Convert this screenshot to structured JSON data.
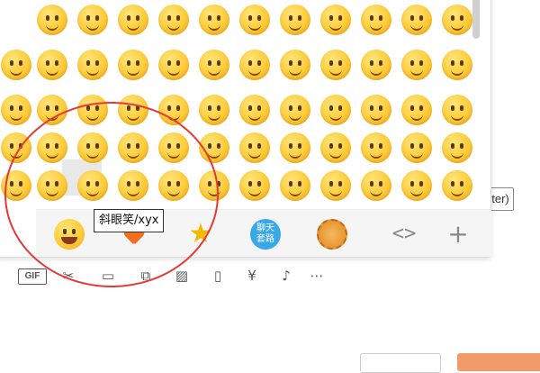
{
  "tooltip": {
    "text": "斜眼笑/xyx"
  },
  "send_hint": {
    "text": "nter)"
  },
  "emoji_panel": {
    "tabs": [
      {
        "name": "default-emoji",
        "icon": "smile-icon"
      },
      {
        "name": "favorites",
        "icon": "heart-icon"
      },
      {
        "name": "starred",
        "icon": "star-icon"
      },
      {
        "name": "chat-routines",
        "icon": "chat-bubble-icon",
        "label_line1": "聊天",
        "label_line2": "套路"
      },
      {
        "name": "mooncake",
        "icon": "mooncake-icon"
      },
      {
        "name": "prev-next",
        "icon": "code-arrows-icon",
        "label": "<>"
      },
      {
        "name": "add",
        "icon": "plus-icon",
        "label": "+"
      }
    ],
    "highlighted_emoji": "斜眼笑/xyx"
  },
  "toolbar": {
    "gif_label": "GIF",
    "items": [
      "gif-icon",
      "scissors-icon",
      "folder-icon",
      "screenshot-icon",
      "image-icon",
      "shake-icon",
      "red-packet-icon",
      "music-icon",
      "more-icon"
    ]
  },
  "colors": {
    "accent": "#f39a6a",
    "annotation": "#e53935",
    "emoji_yellow": "#ffcc3a"
  }
}
